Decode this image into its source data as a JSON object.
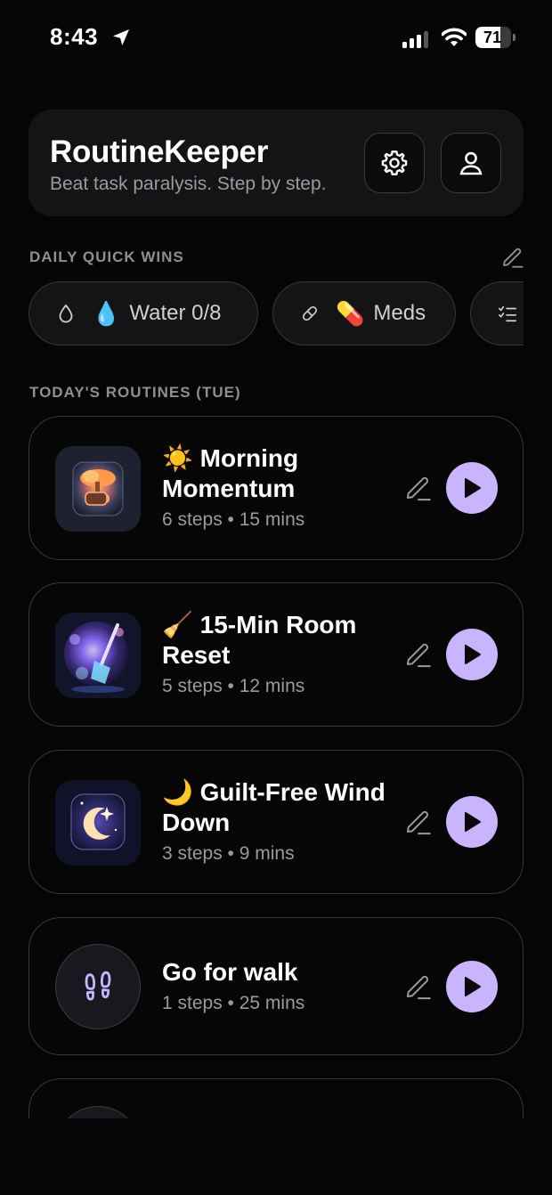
{
  "status_bar": {
    "time": "8:43",
    "battery": "71",
    "battery_level_percent": 71
  },
  "header": {
    "title": "RoutineKeeper",
    "subtitle": "Beat task paralysis. Step by step.",
    "settings_icon": "gear-icon",
    "profile_icon": "person-icon"
  },
  "quick_wins": {
    "section_label": "DAILY QUICK WINS",
    "items": [
      {
        "icon": "drop-icon",
        "emoji": "💧",
        "label": "Water 0/8"
      },
      {
        "icon": "pill-icon",
        "emoji": "💊",
        "label": "Meds"
      },
      {
        "icon": "checklist-icon",
        "emoji": "",
        "label": ""
      }
    ]
  },
  "routines": {
    "section_label": "TODAY'S ROUTINES (TUE)",
    "items": [
      {
        "emoji": "☀️",
        "title": "Morning Momentum",
        "meta": "6 steps • 15 mins",
        "thumb": "sun-coffee-image"
      },
      {
        "emoji": "🧹",
        "title": "15-Min Room Reset",
        "meta": "5 steps • 12 mins",
        "thumb": "broom-sparkle-image"
      },
      {
        "emoji": "🌙",
        "title": "Guilt-Free Wind Down",
        "meta": "3 steps • 9 mins",
        "thumb": "moon-star-image"
      },
      {
        "emoji": "",
        "title": "Go for walk",
        "meta": "1 steps • 25 mins",
        "thumb": "footprints-icon"
      }
    ]
  },
  "colors": {
    "background": "#050506",
    "card": "#141416",
    "accent": "#c9b5ff",
    "muted_text": "#9a9aa0"
  }
}
